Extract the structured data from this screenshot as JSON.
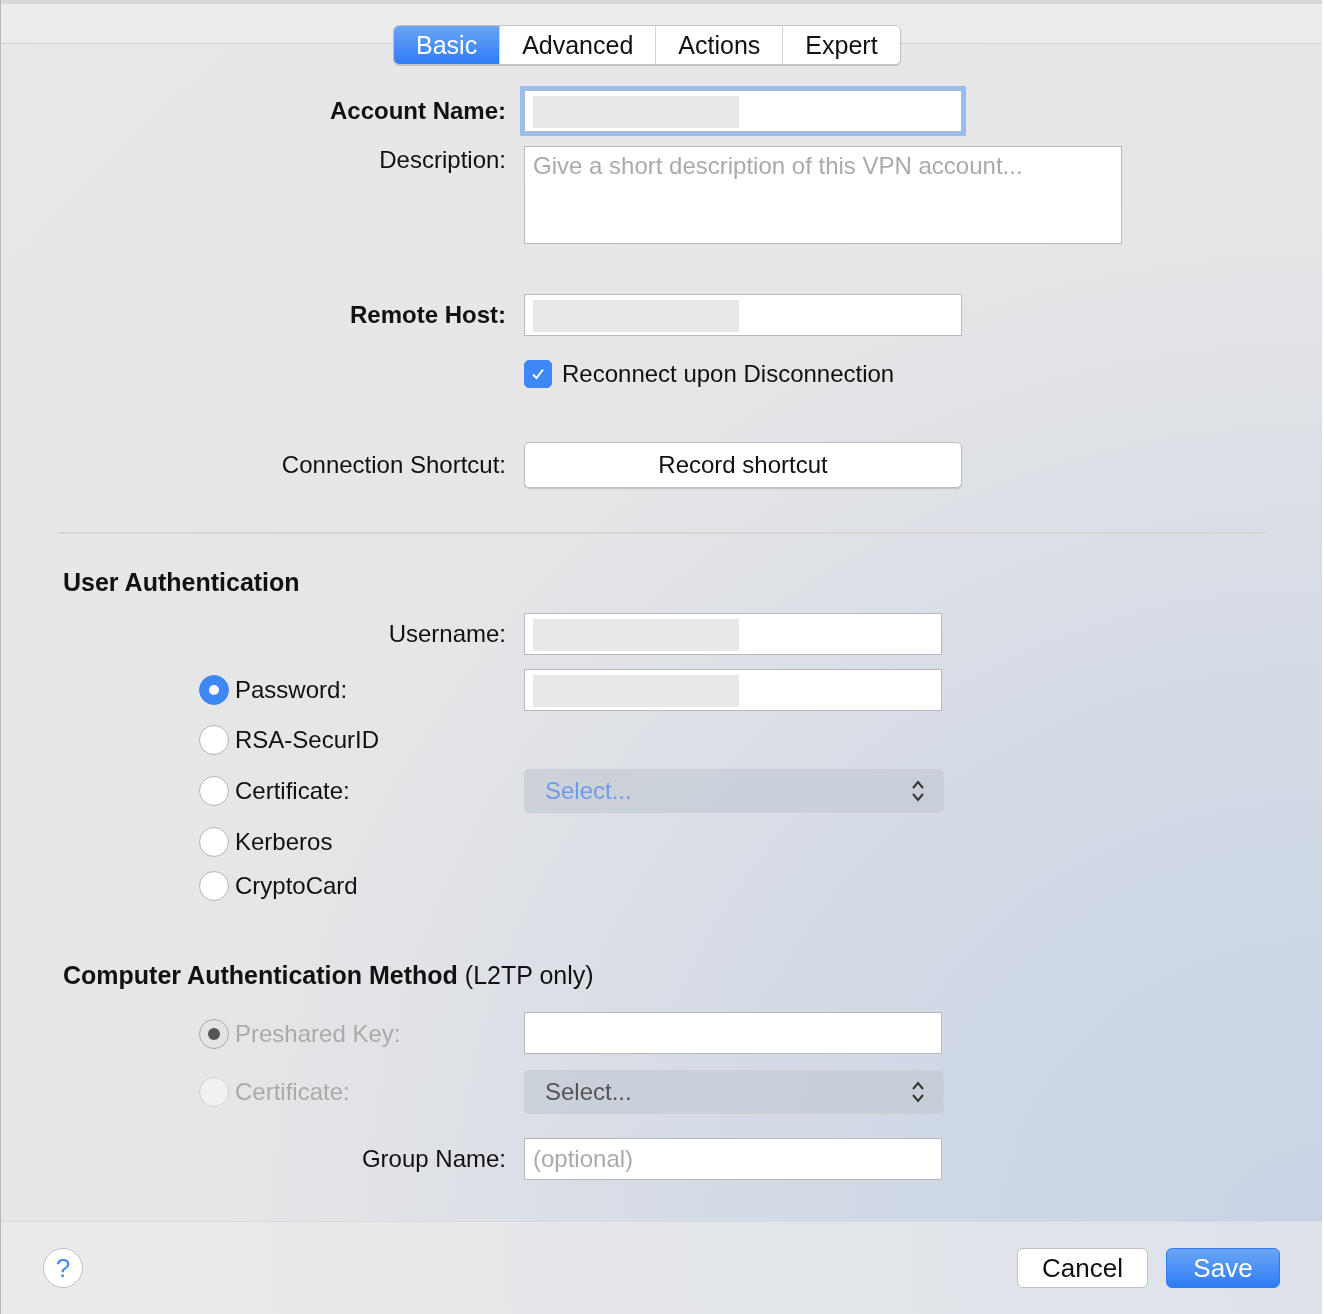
{
  "tabs": [
    {
      "label": "Basic",
      "selected": true
    },
    {
      "label": "Advanced",
      "selected": false
    },
    {
      "label": "Actions",
      "selected": false
    },
    {
      "label": "Expert",
      "selected": false
    }
  ],
  "general": {
    "account_name": {
      "label": "Account Name:",
      "redacted": true,
      "focused": true
    },
    "description": {
      "label": "Description:",
      "placeholder": "Give a short description of this VPN account..."
    },
    "remote_host": {
      "label": "Remote Host:",
      "redacted": true
    },
    "reconnect": {
      "label": "Reconnect upon Disconnection",
      "checked": true
    },
    "connection_shortcut": {
      "label": "Connection Shortcut:",
      "button": "Record shortcut"
    }
  },
  "user_authentication": {
    "heading": "User Authentication",
    "username": {
      "label": "Username:",
      "redacted": true
    },
    "methods": [
      {
        "label": "Password:",
        "selected": true,
        "disabled": false,
        "kind": "field",
        "redacted": true
      },
      {
        "label": "RSA-SecurID",
        "selected": false,
        "disabled": false,
        "kind": "none"
      },
      {
        "label": "Certificate:",
        "selected": false,
        "disabled": false,
        "kind": "select",
        "select": {
          "text": "Select...",
          "disabled": true
        }
      },
      {
        "label": "Kerberos",
        "selected": false,
        "disabled": false,
        "kind": "none"
      },
      {
        "label": "CryptoCard",
        "selected": false,
        "disabled": false,
        "kind": "none"
      }
    ]
  },
  "computer_authentication": {
    "heading": "Computer Authentication Method",
    "note": "(L2TP only)",
    "methods": [
      {
        "label": "Preshared Key:",
        "selected": true,
        "disabled": true,
        "kind": "field",
        "redacted": false
      },
      {
        "label": "Certificate:",
        "selected": false,
        "disabled": true,
        "kind": "select",
        "select": {
          "text": "Select...",
          "disabled": false
        }
      }
    ],
    "group_name": {
      "label": "Group Name:",
      "placeholder": "(optional)"
    }
  },
  "footer": {
    "help": "?",
    "buttons": [
      {
        "label": "Cancel",
        "primary": false
      },
      {
        "label": "Save",
        "primary": true
      }
    ]
  }
}
